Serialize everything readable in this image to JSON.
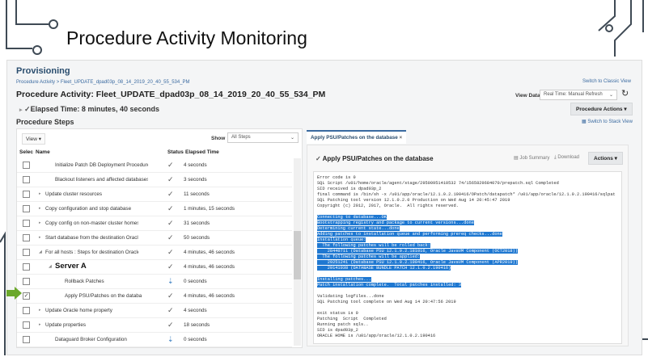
{
  "slide_title": "Procedure Activity Monitoring",
  "header": {
    "section": "Provisioning",
    "breadcrumb": "Procedure Activity > Fleet_UPDATE_dpad03p_08_14_2019_20_40_55_534_PM",
    "title": "Procedure Activity: Fleet_UPDATE_dpad03p_08_14_2019_20_40_55_534_PM",
    "elapsed": "Elapsed Time: 8 minutes, 40 seconds",
    "switch_classic": "Switch to Classic View",
    "view_data_label": "View Data",
    "view_data_value": "Real Time: Manual Refresh",
    "procedure_actions": "Procedure Actions",
    "switch_stack": "Switch to Stack View"
  },
  "steps": {
    "heading": "Procedure Steps",
    "view_menu": "View",
    "show_label": "Show",
    "show_value": "All Steps",
    "columns": [
      "Selec",
      "Name",
      "Status",
      "Elapsed Time"
    ],
    "rows": [
      {
        "name": "Initialize Patch DB Deployment Procedure",
        "status": "success",
        "elapsed": "4 seconds",
        "indent": 2,
        "expand": "",
        "checked": false
      },
      {
        "name": "Blackout listeners and affected databases",
        "status": "success",
        "elapsed": "3 seconds",
        "indent": 2,
        "expand": "",
        "checked": false
      },
      {
        "name": "Update cluster resources",
        "status": "success",
        "elapsed": "11 seconds",
        "indent": 1,
        "expand": "▸",
        "checked": false
      },
      {
        "name": "Copy configuration and stop database",
        "status": "success",
        "elapsed": "1 minutes, 15 seconds",
        "indent": 1,
        "expand": "▸",
        "checked": false
      },
      {
        "name": "Copy config on non-master cluster homes fr",
        "status": "success",
        "elapsed": "31 seconds",
        "indent": 1,
        "expand": "▸",
        "checked": false
      },
      {
        "name": "Start database from the destination Oracle h",
        "status": "success",
        "elapsed": "50 seconds",
        "indent": 1,
        "expand": "▸",
        "checked": false
      },
      {
        "name": "For all hosts : Steps for destination Oracle h",
        "status": "success",
        "elapsed": "4 minutes, 46 seconds",
        "indent": 1,
        "expand": "◢",
        "checked": false
      },
      {
        "name": "Server A",
        "status": "success",
        "elapsed": "4 minutes, 46 seconds",
        "indent": 2,
        "expand": "◢",
        "checked": false,
        "big": true
      },
      {
        "name": "Rollback Patches",
        "status": "skipped",
        "elapsed": "0 seconds",
        "indent": 3,
        "expand": "",
        "checked": false
      },
      {
        "name": "Apply PSU/Patches on the databa",
        "status": "success",
        "elapsed": "4 minutes, 46 seconds",
        "indent": 3,
        "expand": "",
        "checked": true
      },
      {
        "name": "Update Oracle home property",
        "status": "success",
        "elapsed": "4 seconds",
        "indent": 1,
        "expand": "▸",
        "checked": false
      },
      {
        "name": "Update properties",
        "status": "success",
        "elapsed": "18 seconds",
        "indent": 1,
        "expand": "▸",
        "checked": false
      },
      {
        "name": "Dataguard Broker Configuration",
        "status": "skipped",
        "elapsed": "0 seconds",
        "indent": 2,
        "expand": "",
        "checked": false
      }
    ]
  },
  "detail": {
    "tab": "Apply PSU/Patches on the database",
    "title": "Apply PSU/Patches on the database",
    "job_summary": "Job Summary",
    "download": "Download",
    "actions": "Actions",
    "log_pre": [
      "Error code is 0",
      "SQL Script /u01/home/oracle/agent/stage/29500951410532 74/1565829684070/prepatch.sql Completed",
      "SID received is dpad03p_2",
      "final command is /bin/sh -x /u01/app/oracle/12.1.0.2.190416/OPatch/datapatch* /u01/app/oracle/12.1.0.2.190416/sqlpat",
      "SQL Patching tool version 12.1.0.2.0 Production on Wed Aug 14 20:45:47 2019",
      "Copyright (c) 2012, 2017, Oracle.  All rights reserved."
    ],
    "log_hl1": [
      "Connecting to database...OK",
      "Bootstrapping registry and package to current versions...done",
      "Determining current state...done",
      "Adding patches to installation queue and performing prereq checks...done",
      "Installation queue:",
      "  The following patches will be rolled back:",
      "    28440711 (Database PSU 12.1.0.2.181016, Oracle JavaVM Component (OCT2018))",
      "  The following patches will be applied:",
      "    29251241 (Database PSU 12.1.0.2.190416, Oracle JavaVM Component (APR2019))",
      "    29141038 (DATABASE BUNDLE PATCH 12.1.0.2.190416)"
    ],
    "log_hl2": [
      "Installing patches...",
      "Patch installation complete.  Total patches installed: 3"
    ],
    "log_post": [
      "Validating logfiles...done",
      "SQL Patching tool complete on Wed Aug 14 20:47:56 2019",
      "",
      "exit status is 0",
      "Patching  Script  Completed",
      "Running patch sqls..",
      "SID is dpad03p_2",
      "ORACLE HOME is /u01/app/oracle/12.1.0.2.190416"
    ]
  },
  "colors": {
    "accent": "#3a6aa0",
    "highlight": "#1f78d1",
    "arrow": "#6aa82a"
  }
}
